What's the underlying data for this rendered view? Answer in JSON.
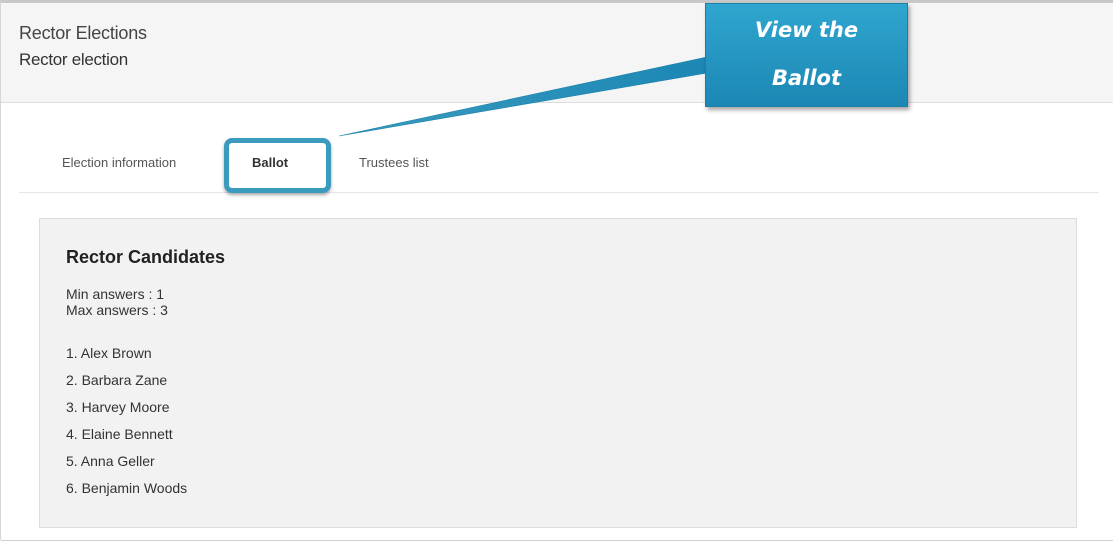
{
  "header": {
    "title": "Rector Elections",
    "subtitle": "Rector election"
  },
  "tabs": [
    {
      "label": "Election information",
      "active": false
    },
    {
      "label": "Ballot",
      "active": true
    },
    {
      "label": "Trustees list",
      "active": false
    }
  ],
  "callout": {
    "line1": "View the",
    "line2": "Ballot"
  },
  "ballot": {
    "question": "Rector Candidates",
    "min_answers": "Min answers : 1",
    "max_answers": "Max answers : 3",
    "answers": [
      "1. Alex Brown",
      "2. Barbara Zane",
      "3. Harvey Moore",
      "4. Elaine Bennett",
      "5. Anna Geller",
      "6. Benjamin Woods"
    ]
  },
  "colors": {
    "accent": "#3a9bbf",
    "callout_top": "#2fa6cf",
    "callout_bottom": "#1c87b4",
    "header_bg": "#f5f5f5",
    "panel_bg": "#f2f2f2"
  }
}
